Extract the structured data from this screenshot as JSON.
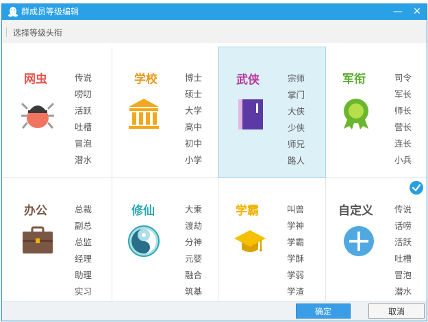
{
  "window": {
    "title": "群成员等级编辑",
    "minimize_glyph": "—",
    "close_glyph": "✕"
  },
  "subbar": {
    "label": "选择等级头衔"
  },
  "categories": [
    {
      "name": "网虫",
      "color": "#e8524a",
      "icon": "bug-icon",
      "ranks": [
        "传说",
        "唠叨",
        "活跃",
        "吐槽",
        "冒泡",
        "潜水"
      ]
    },
    {
      "name": "学校",
      "color": "#e89a1c",
      "icon": "school-building-icon",
      "ranks": [
        "博士",
        "硕士",
        "大学",
        "高中",
        "初中",
        "小学"
      ]
    },
    {
      "name": "武侠",
      "color": "#b7399c",
      "icon": "martial-book-icon",
      "ranks": [
        "宗师",
        "掌门",
        "大侠",
        "少侠",
        "师兄",
        "路人"
      ],
      "selected": true
    },
    {
      "name": "军衔",
      "color": "#5aaa2a",
      "icon": "medal-icon",
      "ranks": [
        "司令",
        "军长",
        "师长",
        "营长",
        "连长",
        "小兵"
      ]
    },
    {
      "name": "办公",
      "color": "#7a5644",
      "icon": "briefcase-icon",
      "ranks": [
        "总裁",
        "副总",
        "总监",
        "经理",
        "助理",
        "实习"
      ]
    },
    {
      "name": "修仙",
      "color": "#2aa8b0",
      "icon": "yin-yang-icon",
      "ranks": [
        "大乘",
        "渡劫",
        "分神",
        "元婴",
        "融合",
        "筑基"
      ]
    },
    {
      "name": "学霸",
      "color": "#f0b400",
      "icon": "graduation-cap-icon",
      "ranks": [
        "叫兽",
        "学神",
        "学霸",
        "学酥",
        "学弱",
        "学渣"
      ]
    },
    {
      "name": "自定义",
      "color": "#555555",
      "icon": "plus-icon",
      "ranks": [
        "传说",
        "话唠",
        "活跃",
        "吐槽",
        "冒泡",
        "潜水"
      ],
      "checked": true
    }
  ],
  "footer": {
    "ok_label": "确定",
    "cancel_label": "取消"
  }
}
